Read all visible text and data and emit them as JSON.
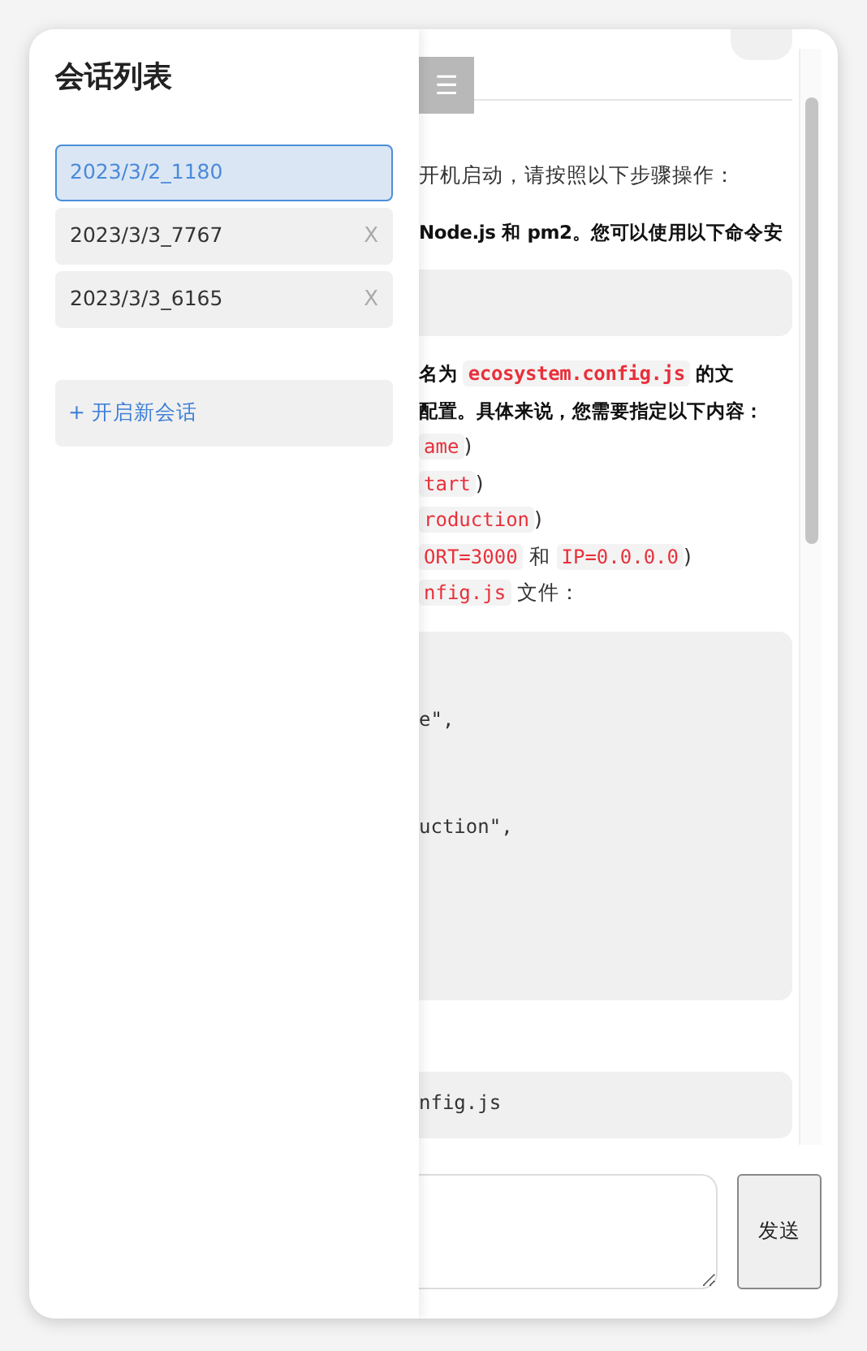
{
  "sidebar": {
    "title": "会话列表",
    "sessions": [
      {
        "label": "2023/3/2_1180",
        "selected": true
      },
      {
        "label": "2023/3/3_7767",
        "selected": false,
        "close": "X"
      },
      {
        "label": "2023/3/3_6165",
        "selected": false,
        "close": "X"
      }
    ],
    "new_session": "+ 开启新会话"
  },
  "header": {
    "menu_glyph": "☰"
  },
  "messages": [
    {
      "kind": "text",
      "bold": false,
      "parts": [
        {
          "kind": "plain",
          "text": "开机启动，请按照以下步骤操作："
        }
      ]
    },
    {
      "kind": "text",
      "bold": true,
      "parts": [
        {
          "kind": "plain",
          "text": "Node.js 和 pm2。您可以使用以下命令安"
        }
      ]
    },
    {
      "kind": "code_block"
    },
    {
      "kind": "text",
      "bold": true,
      "parts": [
        {
          "kind": "plain",
          "text": "名为 "
        },
        {
          "kind": "code",
          "text": "ecosystem.config.js"
        },
        {
          "kind": "plain",
          "text": " 的文"
        }
      ]
    },
    {
      "kind": "text",
      "bold": true,
      "parts": [
        {
          "kind": "plain",
          "text": "配置。具体来说，您需要指定以下内容："
        }
      ]
    },
    {
      "kind": "text",
      "bold": false,
      "parts": [
        {
          "kind": "code",
          "text": "ame"
        },
        {
          "kind": "plain",
          "text": ")"
        }
      ]
    },
    {
      "kind": "text",
      "bold": false,
      "parts": [
        {
          "kind": "code",
          "text": "tart"
        },
        {
          "kind": "plain",
          "text": ")"
        }
      ]
    },
    {
      "kind": "text",
      "bold": false,
      "parts": [
        {
          "kind": "code",
          "text": "roduction"
        },
        {
          "kind": "plain",
          "text": ")"
        }
      ]
    },
    {
      "kind": "text",
      "bold": false,
      "parts": [
        {
          "kind": "code",
          "text": "ORT=3000"
        },
        {
          "kind": "plain",
          "text": " 和 "
        },
        {
          "kind": "code",
          "text": "IP=0.0.0.0"
        },
        {
          "kind": "plain",
          "text": ")"
        }
      ]
    },
    {
      "kind": "text",
      "bold": false,
      "parts": [
        {
          "kind": "code",
          "text": "nfig.js"
        },
        {
          "kind": "plain",
          "text": " 文件："
        }
      ]
    },
    {
      "kind": "code_block",
      "lines": [
        "e\",",
        "uction\","
      ]
    },
    {
      "kind": "code_block",
      "lines": [
        "nfig.js"
      ]
    }
  ],
  "composer": {
    "send": "发送"
  }
}
